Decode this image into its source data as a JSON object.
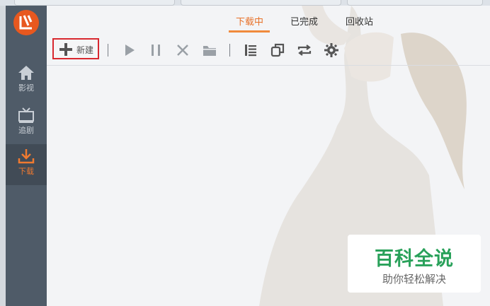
{
  "sidebar": {
    "items": [
      {
        "label": "影视",
        "icon": "home-icon"
      },
      {
        "label": "追剧",
        "icon": "tv-icon"
      },
      {
        "label": "下载",
        "icon": "download-icon"
      }
    ],
    "active": "下载"
  },
  "tabs": [
    {
      "label": "下载中"
    },
    {
      "label": "已完成"
    },
    {
      "label": "回收站"
    }
  ],
  "toolbar": {
    "new_label": "新建",
    "tools": [
      "play-icon",
      "pause-icon",
      "delete-icon",
      "folder-icon",
      "list-icon",
      "copy-icon",
      "refresh-icon",
      "gear-icon"
    ]
  },
  "watermark": {
    "title": "百科全说",
    "subtitle": "助你轻松解决"
  },
  "colors": {
    "accent": "#e8722a",
    "sidebar_bg": "#4f5b68",
    "watermark_green": "#29a15a",
    "highlight_border": "#d8282f"
  }
}
